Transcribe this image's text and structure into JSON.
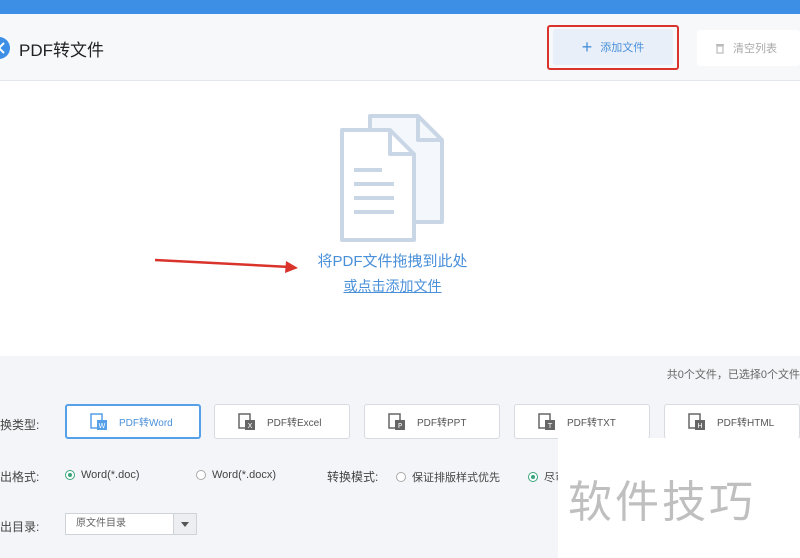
{
  "header": {
    "title": "PDF转文件",
    "add_label": "添加文件",
    "clear_label": "清空列表"
  },
  "dropzone": {
    "line1": "将PDF文件拖拽到此处",
    "line2": "或点击添加文件"
  },
  "status": {
    "file_count": "共0个文件，已选择0个文件"
  },
  "convert_type": {
    "label": "换类型:",
    "options": [
      {
        "label": "PDF转Word",
        "icon": "word-file-icon"
      },
      {
        "label": "PDF转Excel",
        "icon": "excel-file-icon"
      },
      {
        "label": "PDF转PPT",
        "icon": "ppt-file-icon"
      },
      {
        "label": "PDF转TXT",
        "icon": "txt-file-icon"
      },
      {
        "label": "PDF转HTML",
        "icon": "html-file-icon"
      }
    ]
  },
  "output_format": {
    "label": "出格式:",
    "options": [
      "Word(*.doc)",
      "Word(*.docx)"
    ],
    "mode_label": "转换模式:",
    "mode_options": [
      "保证排版样式优先",
      "尽可"
    ]
  },
  "output_dir": {
    "label": "出目录:",
    "value": "原文件目录"
  },
  "watermark": {
    "text": "软件技巧"
  },
  "colors": {
    "accent": "#3d8fe6",
    "link": "#4a90d9",
    "highlight": "#d9332c",
    "radio_checked": "#3aa57a"
  }
}
